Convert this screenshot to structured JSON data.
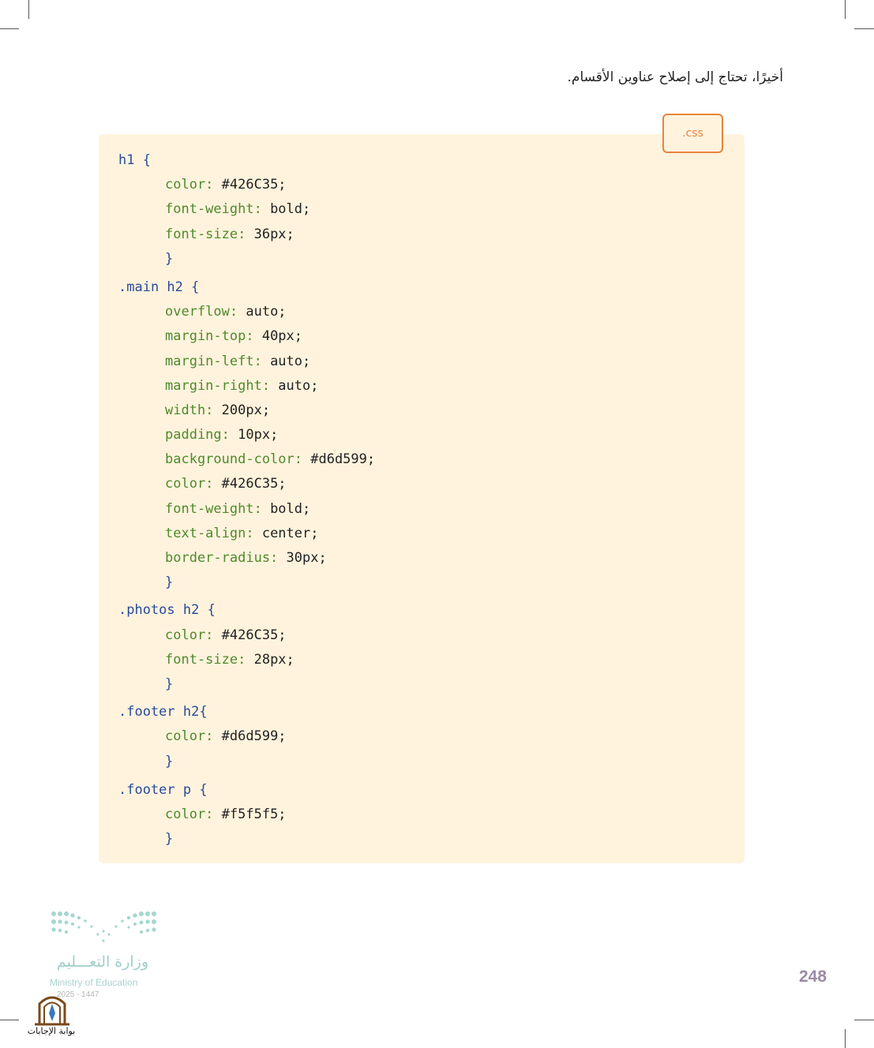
{
  "intro_text": "أخيرًا، تحتاج إلى إصلاح عناوين الأقسام.",
  "code_tag": ".css",
  "code_lines": [
    [
      {
        "t": "sel",
        "v": "h1 "
      },
      {
        "t": "brace",
        "v": "{"
      }
    ],
    [
      {
        "t": "prop",
        "v": "color: "
      },
      {
        "t": "val",
        "v": "#426C35;"
      }
    ],
    [
      {
        "t": "prop",
        "v": "font-weight: "
      },
      {
        "t": "val",
        "v": "bold;"
      }
    ],
    [
      {
        "t": "prop",
        "v": "font-size: "
      },
      {
        "t": "val",
        "v": "36px;"
      }
    ],
    [
      {
        "t": "brace",
        "v": "}"
      }
    ],
    [
      {
        "t": "sel",
        "v": ".main h2 "
      },
      {
        "t": "brace",
        "v": "{"
      }
    ],
    [
      {
        "t": "prop",
        "v": "overflow: "
      },
      {
        "t": "val",
        "v": "auto;"
      }
    ],
    [
      {
        "t": "prop",
        "v": "margin-top: "
      },
      {
        "t": "val",
        "v": "40px;"
      }
    ],
    [
      {
        "t": "prop",
        "v": "margin-left: "
      },
      {
        "t": "val",
        "v": "auto;"
      }
    ],
    [
      {
        "t": "prop",
        "v": "margin-right: "
      },
      {
        "t": "val",
        "v": "auto;"
      }
    ],
    [
      {
        "t": "prop",
        "v": "width: "
      },
      {
        "t": "val",
        "v": "200px;"
      }
    ],
    [
      {
        "t": "prop",
        "v": "padding: "
      },
      {
        "t": "val",
        "v": "10px;"
      }
    ],
    [
      {
        "t": "prop",
        "v": "background-color: "
      },
      {
        "t": "val",
        "v": "#d6d599;"
      }
    ],
    [
      {
        "t": "prop",
        "v": "color: "
      },
      {
        "t": "val",
        "v": "#426C35;"
      }
    ],
    [
      {
        "t": "prop",
        "v": "font-weight: "
      },
      {
        "t": "val",
        "v": "bold;"
      }
    ],
    [
      {
        "t": "prop",
        "v": "text-align: "
      },
      {
        "t": "val",
        "v": "center;"
      }
    ],
    [
      {
        "t": "prop",
        "v": "border-radius: "
      },
      {
        "t": "val",
        "v": "30px;"
      }
    ],
    [
      {
        "t": "brace",
        "v": "}"
      }
    ],
    [
      {
        "t": "sel",
        "v": ".photos h2 "
      },
      {
        "t": "brace",
        "v": "{"
      }
    ],
    [
      {
        "t": "prop",
        "v": "color: "
      },
      {
        "t": "val",
        "v": "#426C35;"
      }
    ],
    [
      {
        "t": "prop",
        "v": "font-size: "
      },
      {
        "t": "val",
        "v": "28px;"
      }
    ],
    [
      {
        "t": "brace",
        "v": "}"
      }
    ],
    [
      {
        "t": "sel",
        "v": ".footer h2"
      },
      {
        "t": "brace",
        "v": "{"
      }
    ],
    [
      {
        "t": "prop",
        "v": "color: "
      },
      {
        "t": "val",
        "v": "#d6d599;"
      }
    ],
    [
      {
        "t": "brace",
        "v": "}"
      }
    ],
    [
      {
        "t": "sel",
        "v": ".footer p "
      },
      {
        "t": "brace",
        "v": "{"
      }
    ],
    [
      {
        "t": "prop",
        "v": "color: "
      },
      {
        "t": "val",
        "v": "#f5f5f5;"
      }
    ],
    [
      {
        "t": "brace",
        "v": "}"
      }
    ]
  ],
  "logo": {
    "arabic": "وزارة التعـــليم",
    "english": "Ministry of Education",
    "years": "2025 - 1447"
  },
  "page_number": "248",
  "watermark_text": "بوابة الإجابات"
}
